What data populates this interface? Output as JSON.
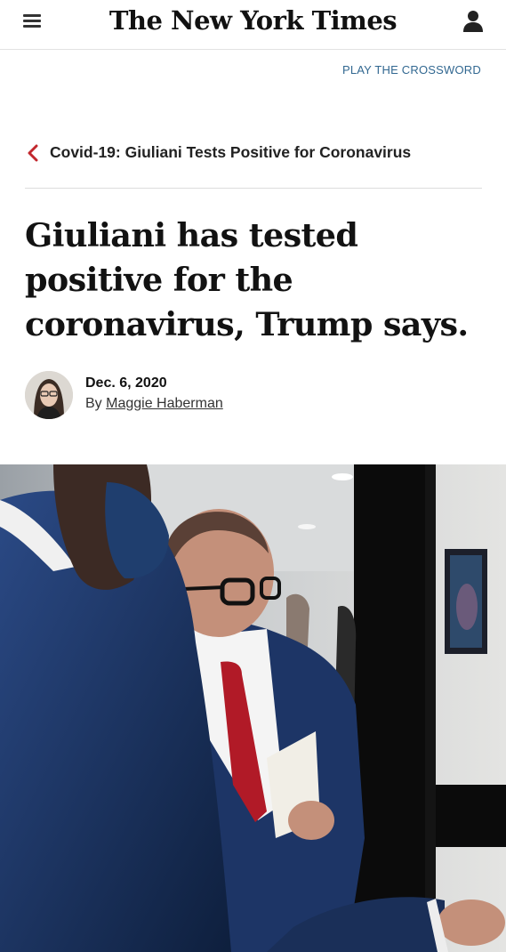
{
  "header": {
    "logo_text": "The New York Times",
    "menu_icon": "hamburger-icon",
    "account_icon": "user-icon"
  },
  "crossword_link": "PLAY THE CROSSWORD",
  "back_link": {
    "icon": "chevron-left-icon",
    "label": "Covid-19: Giuliani Tests Positive for Coronavirus"
  },
  "article": {
    "headline": "Giuliani has tested positive for the coronavirus, Trump says.",
    "date": "Dec. 6, 2020",
    "byline_prefix": "By",
    "author": "Maggie Haberman"
  },
  "colors": {
    "link_blue": "#326891",
    "back_chevron_red": "#c2272d",
    "divider": "#dcdcdc"
  }
}
